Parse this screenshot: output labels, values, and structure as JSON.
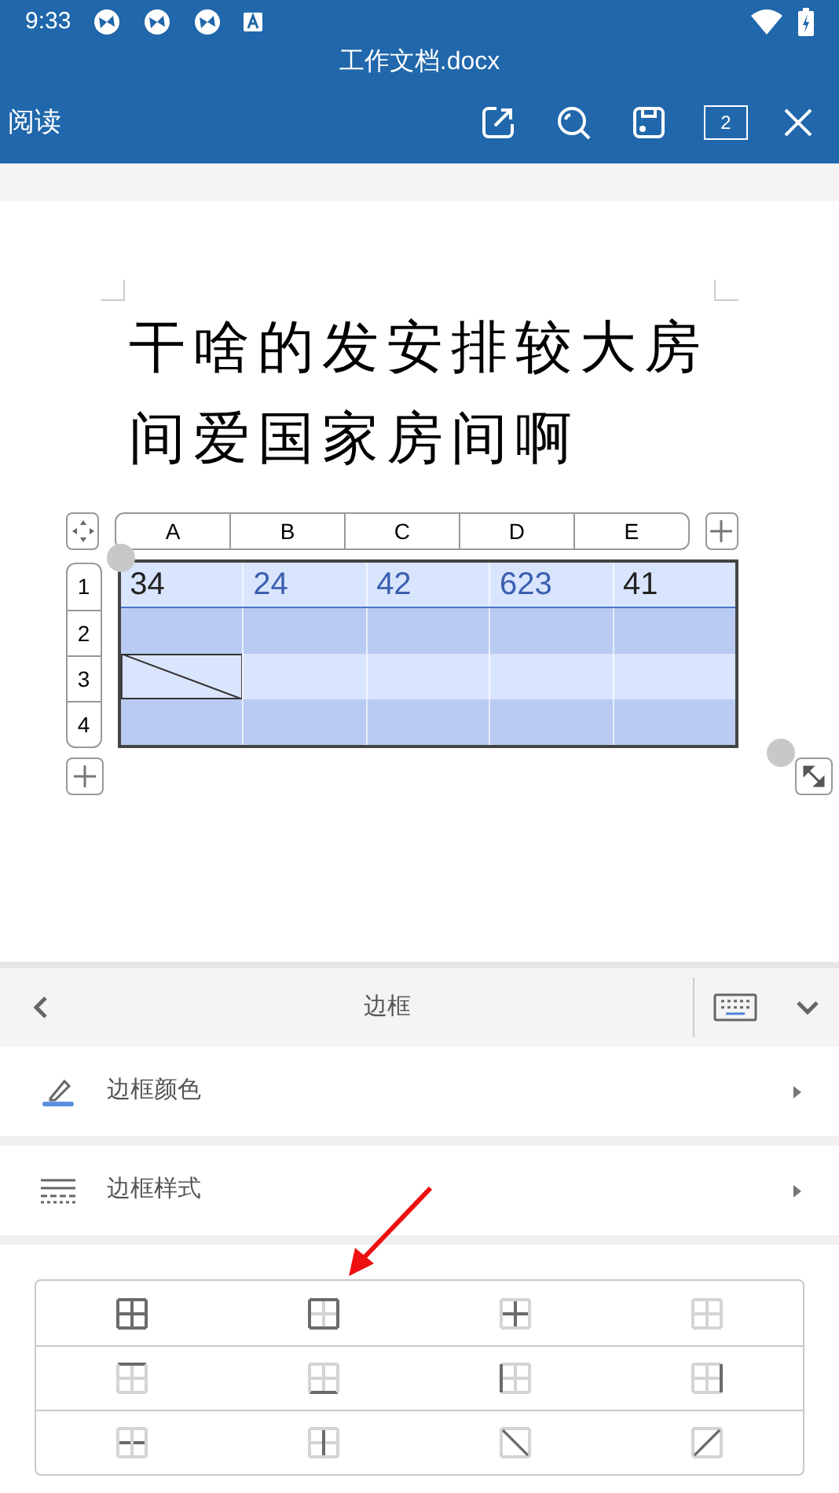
{
  "status_bar": {
    "time": "9:33"
  },
  "title_bar": {
    "title": "工作文档.docx"
  },
  "toolbar": {
    "mode": "阅读",
    "page_count": "2"
  },
  "document": {
    "paragraph": "干啥的发安排较大房间爱国家房间啊"
  },
  "table": {
    "columns": [
      "A",
      "B",
      "C",
      "D",
      "E"
    ],
    "rows": [
      {
        "label": "1",
        "selected": true,
        "cells": [
          {
            "text": "34",
            "color": "#222222"
          },
          {
            "text": "24",
            "color": "#3a5fb0"
          },
          {
            "text": "42",
            "color": "#3a5fb0"
          },
          {
            "text": "623",
            "color": "#3a5fb0"
          },
          {
            "text": "41",
            "color": "#222222"
          }
        ]
      },
      {
        "label": "2",
        "selected": true
      },
      {
        "label": "3",
        "selected": true,
        "cells": [
          {
            "diagonal": true
          },
          {
            "diagonal": false
          },
          {
            "diagonal": false
          },
          {
            "diagonal": false
          },
          {
            "diagonal": false
          }
        ]
      },
      {
        "label": "4",
        "selected": true
      }
    ]
  },
  "panel": {
    "title": "边框",
    "items": [
      {
        "kind": "color",
        "label": "边框颜色"
      },
      {
        "kind": "style",
        "label": "边框样式"
      }
    ],
    "border_options": [
      {
        "kind": "all"
      },
      {
        "kind": "outer"
      },
      {
        "kind": "inner"
      },
      {
        "kind": "none"
      },
      {
        "kind": "top"
      },
      {
        "kind": "bottom"
      },
      {
        "kind": "left"
      },
      {
        "kind": "right"
      },
      {
        "kind": "inner-horizontal"
      },
      {
        "kind": "inner-vertical"
      },
      {
        "kind": "diagonal-down"
      },
      {
        "kind": "diagonal-up"
      }
    ]
  }
}
